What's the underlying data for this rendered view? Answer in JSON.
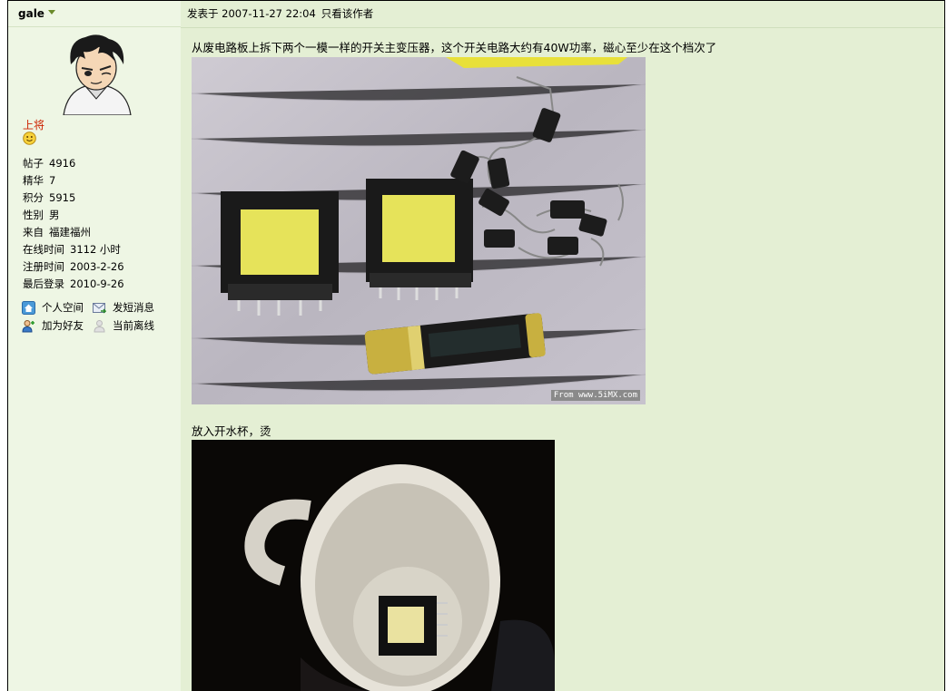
{
  "user": {
    "name": "gale",
    "rank": "上将",
    "stats": [
      {
        "key": "帖子",
        "value": "4916"
      },
      {
        "key": "精华",
        "value": "7"
      },
      {
        "key": "积分",
        "value": "5915"
      },
      {
        "key": "性别",
        "value": "男"
      },
      {
        "key": "来自",
        "value": "福建福州"
      },
      {
        "key": "在线时间",
        "value": "3112 小时"
      },
      {
        "key": "注册时间",
        "value": "2003-2-26"
      },
      {
        "key": "最后登录",
        "value": "2010-9-26"
      }
    ],
    "actions": {
      "home": "个人空间",
      "message": "发短消息",
      "add_friend": "加为好友",
      "status": "当前离线"
    }
  },
  "post": {
    "posted_at": "发表于 2007-11-27 22:04",
    "only_author": "只看该作者",
    "paragraph1": "从废电路板上拆下两个一模一样的开关主变压器，这个开关电路大约有40W功率，磁心至少在这个档次了",
    "watermark": "From www.5iMX.com",
    "paragraph2": "放入开水杯，烫"
  },
  "colors": {
    "sidebar_bg": "#eef6e4",
    "main_bg": "#e4efd4",
    "rank_color": "#cc2200"
  },
  "icons": [
    "caret-down-icon",
    "smiley-icon",
    "home-icon",
    "message-icon",
    "add-friend-icon",
    "offline-user-icon"
  ]
}
